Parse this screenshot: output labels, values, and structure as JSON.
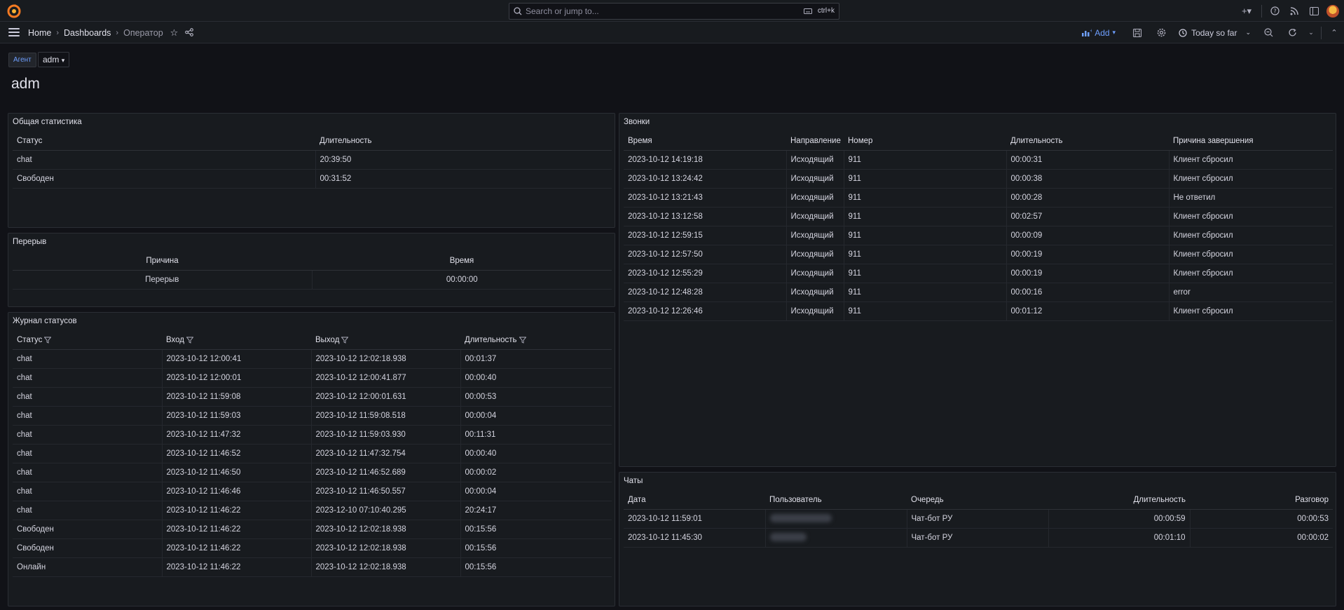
{
  "topbar": {
    "search_placeholder": "Search or jump to...",
    "search_shortcut": "ctrl+k"
  },
  "breadcrumb": {
    "home": "Home",
    "dashboards": "Dashboards",
    "current": "Оператор"
  },
  "toolbar": {
    "add_label": "Add",
    "time_range": "Today so far"
  },
  "variables": {
    "agent_label": "Агент",
    "agent_value": "adm"
  },
  "page_title": "adm",
  "general_stats": {
    "title": "Общая статистика",
    "columns": [
      "Статус",
      "Длительность"
    ],
    "rows": [
      [
        "chat",
        "20:39:50"
      ],
      [
        "Свободен",
        "00:31:52"
      ]
    ]
  },
  "breaks": {
    "title": "Перерыв",
    "columns": [
      "Причина",
      "Время"
    ],
    "rows": [
      [
        "Перерыв",
        "00:00:00"
      ]
    ]
  },
  "status_log": {
    "title": "Журнал статусов",
    "columns": [
      "Статус",
      "Вход",
      "Выход",
      "Длительность"
    ],
    "rows": [
      [
        "chat",
        "2023-10-12 12:00:41",
        "2023-10-12 12:02:18.938",
        "00:01:37"
      ],
      [
        "chat",
        "2023-10-12 12:00:01",
        "2023-10-12 12:00:41.877",
        "00:00:40"
      ],
      [
        "chat",
        "2023-10-12 11:59:08",
        "2023-10-12 12:00:01.631",
        "00:00:53"
      ],
      [
        "chat",
        "2023-10-12 11:59:03",
        "2023-10-12 11:59:08.518",
        "00:00:04"
      ],
      [
        "chat",
        "2023-10-12 11:47:32",
        "2023-10-12 11:59:03.930",
        "00:11:31"
      ],
      [
        "chat",
        "2023-10-12 11:46:52",
        "2023-10-12 11:47:32.754",
        "00:00:40"
      ],
      [
        "chat",
        "2023-10-12 11:46:50",
        "2023-10-12 11:46:52.689",
        "00:00:02"
      ],
      [
        "chat",
        "2023-10-12 11:46:46",
        "2023-10-12 11:46:50.557",
        "00:00:04"
      ],
      [
        "chat",
        "2023-10-12 11:46:22",
        "2023-12-10 07:10:40.295",
        "20:24:17"
      ],
      [
        "Свободен",
        "2023-10-12 11:46:22",
        "2023-10-12 12:02:18.938",
        "00:15:56"
      ],
      [
        "Свободен",
        "2023-10-12 11:46:22",
        "2023-10-12 12:02:18.938",
        "00:15:56"
      ],
      [
        "Онлайн",
        "2023-10-12 11:46:22",
        "2023-10-12 12:02:18.938",
        "00:15:56"
      ]
    ]
  },
  "calls": {
    "title": "Звонки",
    "columns": [
      "Время",
      "Направление",
      "Номер",
      "Длительность",
      "Причина завершения"
    ],
    "rows": [
      [
        "2023-10-12 14:19:18",
        "Исходящий",
        "911",
        "00:00:31",
        "Клиент сбросил"
      ],
      [
        "2023-10-12 13:24:42",
        "Исходящий",
        "911",
        "00:00:38",
        "Клиент сбросил"
      ],
      [
        "2023-10-12 13:21:43",
        "Исходящий",
        "911",
        "00:00:28",
        "Не ответил"
      ],
      [
        "2023-10-12 13:12:58",
        "Исходящий",
        "911",
        "00:02:57",
        "Клиент сбросил"
      ],
      [
        "2023-10-12 12:59:15",
        "Исходящий",
        "911",
        "00:00:09",
        "Клиент сбросил"
      ],
      [
        "2023-10-12 12:57:50",
        "Исходящий",
        "911",
        "00:00:19",
        "Клиент сбросил"
      ],
      [
        "2023-10-12 12:55:29",
        "Исходящий",
        "911",
        "00:00:19",
        "Клиент сбросил"
      ],
      [
        "2023-10-12 12:48:28",
        "Исходящий",
        "911",
        "00:00:16",
        "error"
      ],
      [
        "2023-10-12 12:26:46",
        "Исходящий",
        "911",
        "00:01:12",
        "Клиент сбросил"
      ]
    ]
  },
  "chats": {
    "title": "Чаты",
    "columns": [
      "Дата",
      "Пользователь",
      "Очередь",
      "Длительность",
      "Разговор"
    ],
    "rows": [
      [
        "2023-10-12 11:59:01",
        "Чат-бот РУ",
        "00:00:59",
        "00:00:53"
      ],
      [
        "2023-10-12 11:45:30",
        "Чат-бот РУ",
        "00:01:10",
        "00:00:02"
      ]
    ]
  }
}
